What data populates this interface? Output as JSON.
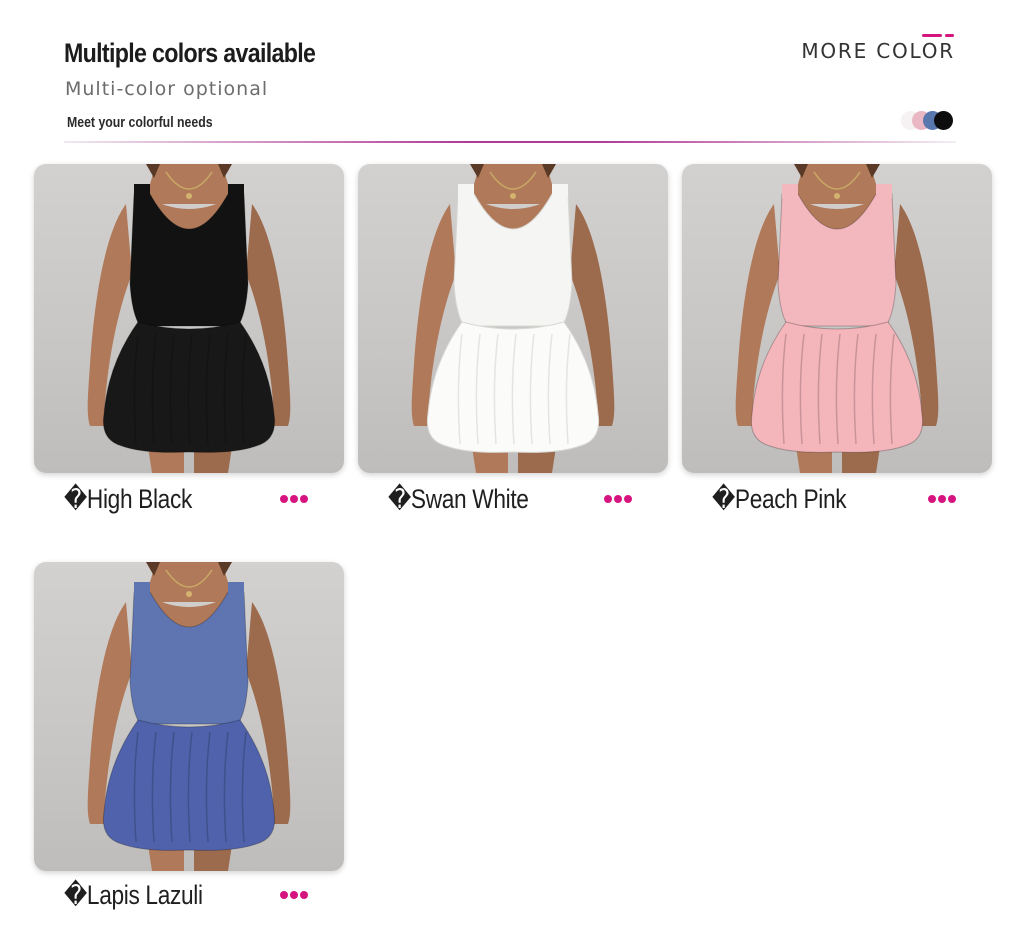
{
  "header": {
    "title": "Multiple colors available",
    "subtitle": "Multi-color optional",
    "tagline": "Meet your colorful needs",
    "more_color_label": "MORE COLOR",
    "accent_color": "#d6147f",
    "swatch_colors": [
      "#f6f1f2",
      "#eab8c4",
      "#5777ad",
      "#0d0d0d"
    ]
  },
  "products": [
    {
      "label": "�High Black",
      "color_name": "High Black",
      "dress_color": "#121212",
      "skirt_color": "#181818",
      "icon": "more-dots-icon"
    },
    {
      "label": "�Swan White",
      "color_name": "Swan White",
      "dress_color": "#f5f5f3",
      "skirt_color": "#fbfbfa",
      "icon": "more-dots-icon"
    },
    {
      "label": "�Peach Pink",
      "color_name": "Peach Pink",
      "dress_color": "#f3b8bd",
      "skirt_color": "#f4b5bb",
      "icon": "more-dots-icon"
    },
    {
      "label": "�Lapis Lazuli",
      "color_name": "Lapis Lazuli",
      "dress_color": "#5f75b2",
      "skirt_color": "#4f62ab",
      "icon": "more-dots-icon"
    }
  ]
}
